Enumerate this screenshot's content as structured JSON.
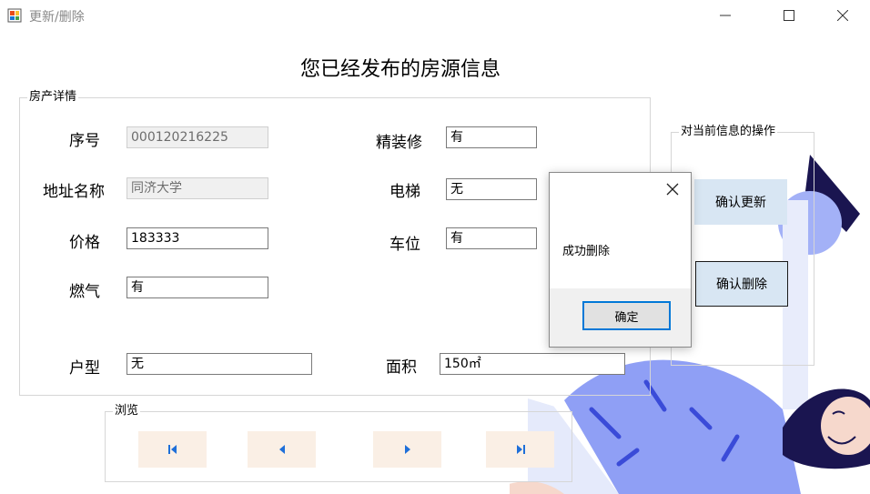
{
  "window": {
    "title": "更新/删除",
    "icon": "app-icon",
    "controls": [
      "minimize-icon",
      "maximize-icon",
      "close-icon"
    ]
  },
  "heading": "您已经发布的房源信息",
  "details": {
    "legend": "房产详情",
    "fields": {
      "serial": {
        "label": "序号",
        "value": "000120216225"
      },
      "address": {
        "label": "地址名称",
        "value": "同济大学"
      },
      "price": {
        "label": "价格",
        "value": "183333"
      },
      "gas": {
        "label": "燃气",
        "value": "有"
      },
      "layout": {
        "label": "户型",
        "value": "无"
      },
      "decoration": {
        "label": "精装修",
        "value": "有"
      },
      "elevator": {
        "label": "电梯",
        "value": "无"
      },
      "parking": {
        "label": "车位",
        "value": "有"
      },
      "area": {
        "label": "面积",
        "value": "150㎡"
      }
    }
  },
  "operations": {
    "legend": "对当前信息的操作",
    "confirm_update": "确认更新",
    "confirm_delete": "确认删除"
  },
  "browse": {
    "legend": "浏览",
    "buttons": [
      "first-record-icon",
      "previous-record-icon",
      "next-record-icon",
      "last-record-icon"
    ]
  },
  "message_box": {
    "text": "成功删除",
    "ok": "确定"
  },
  "colors": {
    "op_button_bg": "#d8e6f3",
    "nav_button_bg": "#faefe5",
    "nav_icon": "#1e6fd9",
    "ok_border": "#0078d7",
    "illustration_blue": "#8f9ff5",
    "illustration_navy": "#1a1550"
  }
}
